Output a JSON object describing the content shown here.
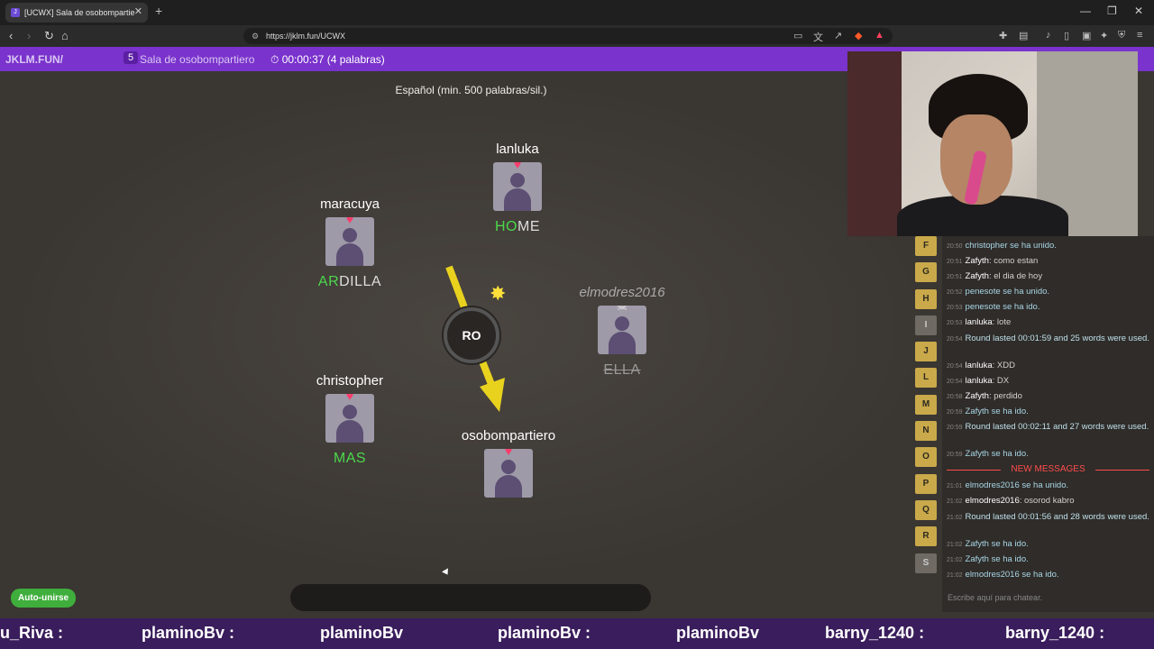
{
  "browser": {
    "tab_title": "[UCWX] Sala de osobompartie",
    "url": "https://jklm.fun/UCWX"
  },
  "gamebar": {
    "brand": "JKLM.FUN/",
    "player_count": "5",
    "room_name": "Sala de osobompartiero",
    "timer": "00:00:37 (4 palabras)"
  },
  "game": {
    "language": "Español (min. 500 palabras/sil.)",
    "syllable": "RO",
    "players": [
      {
        "name": "lanluka",
        "word_hl": "HO",
        "word_rest": "ME"
      },
      {
        "name": "maracuya",
        "word_hl": "AR",
        "word_rest": "DILLA"
      },
      {
        "name": "elmodres2016",
        "word": "ELLA"
      },
      {
        "name": "christopher",
        "word": "MAS"
      },
      {
        "name": "osobompartiero"
      }
    ],
    "auto_join": "Auto-unirse"
  },
  "letters": [
    "F",
    "G",
    "H",
    "I",
    "J",
    "L",
    "M",
    "N",
    "O",
    "P",
    "Q",
    "R",
    "S"
  ],
  "chat": {
    "messages": [
      {
        "time": "20:50",
        "text": "christopher se ha unido."
      },
      {
        "time": "20:51",
        "user": "Zafyth",
        "text": ": como estan"
      },
      {
        "time": "20:51",
        "user": "Zafyth",
        "text": ": el dia de hoy"
      },
      {
        "time": "20:52",
        "text": "penesote se ha unido."
      },
      {
        "time": "20:53",
        "text": "penesote se ha ido."
      },
      {
        "time": "20:53",
        "user": "lanluka",
        "text": ": lote"
      },
      {
        "time": "20:54",
        "text": "Round lasted 00:01:59 and 25 words were used."
      },
      {
        "time": "20:54",
        "user": "lanluka",
        "text": ": XDD"
      },
      {
        "time": "20:54",
        "user": "lanluka",
        "text": ": DX"
      },
      {
        "time": "20:58",
        "user": "Zafyth",
        "text": ": perdido"
      },
      {
        "time": "20:59",
        "text": "Zafyth se ha ido."
      },
      {
        "time": "20:59",
        "text": "Round lasted 00:02:11 and 27 words were used."
      },
      {
        "time": "20:59",
        "text": "Zafyth se ha ido."
      },
      {
        "time": "21:01",
        "text": "elmodres2016 se ha unido."
      },
      {
        "time": "21:02",
        "user": "elmodres2016",
        "text": ": osorod kabro"
      },
      {
        "time": "21:02",
        "text": "Round lasted 00:01:56 and 28 words were used."
      },
      {
        "time": "21:02",
        "text": "Zafyth se ha ido."
      },
      {
        "time": "21:02",
        "text": "Zafyth se ha ido."
      },
      {
        "time": "21:02",
        "text": "elmodres2016 se ha ido."
      }
    ],
    "new_messages": "NEW MESSAGES",
    "input_placeholder": "Escribe aquí para chatear."
  },
  "ticker": {
    "items": [
      "u_Riva :",
      "plaminoBv :",
      "plaminoBv",
      "plaminoBv :",
      "plaminoBv",
      "barny_1240 :",
      "barny_1240 :"
    ]
  }
}
